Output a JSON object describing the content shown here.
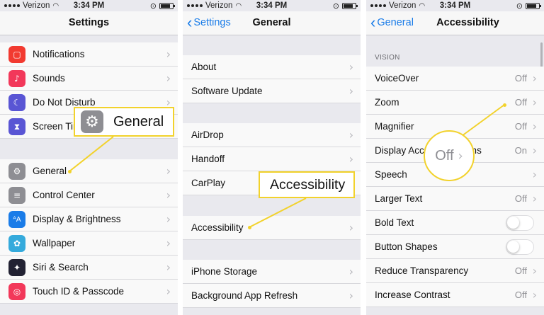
{
  "status_bar": {
    "carrier": "Verizon",
    "time": "3:34 PM"
  },
  "panel_settings": {
    "title": "Settings",
    "items": [
      {
        "label": "Notifications",
        "icon": "notifications-icon",
        "color": "#f23a30"
      },
      {
        "label": "Sounds",
        "icon": "sounds-icon",
        "color": "#f2385a"
      },
      {
        "label": "Do Not Disturb",
        "icon": "moon-icon",
        "color": "#5955d4"
      },
      {
        "label": "Screen Time",
        "icon": "hourglass-icon",
        "color": "#5955d4"
      },
      {
        "label": "General",
        "icon": "gear-icon",
        "color": "#8e8e93"
      },
      {
        "label": "Control Center",
        "icon": "switches-icon",
        "color": "#8e8e93"
      },
      {
        "label": "Display & Brightness",
        "icon": "text-size-icon",
        "color": "#1a7ce8"
      },
      {
        "label": "Wallpaper",
        "icon": "flower-icon",
        "color": "#35aadc"
      },
      {
        "label": "Siri & Search",
        "icon": "siri-icon",
        "color": "#222233"
      },
      {
        "label": "Touch ID & Passcode",
        "icon": "fingerprint-icon",
        "color": "#f2385a"
      }
    ]
  },
  "panel_general": {
    "back": "Settings",
    "title": "General",
    "items": [
      {
        "label": "About"
      },
      {
        "label": "Software Update"
      },
      {
        "label": "AirDrop"
      },
      {
        "label": "Handoff"
      },
      {
        "label": "CarPlay"
      },
      {
        "label": "Accessibility"
      },
      {
        "label": "iPhone Storage"
      },
      {
        "label": "Background App Refresh"
      }
    ]
  },
  "panel_accessibility": {
    "back": "General",
    "title": "Accessibility",
    "section": "VISION",
    "items": [
      {
        "label": "VoiceOver",
        "value": "Off"
      },
      {
        "label": "Zoom",
        "value": "Off"
      },
      {
        "label": "Magnifier",
        "value": "Off"
      },
      {
        "label": "Display Accommodations",
        "value": "On"
      },
      {
        "label": "Speech",
        "value": ""
      },
      {
        "label": "Larger Text",
        "value": "Off"
      },
      {
        "label": "Bold Text",
        "toggle": "off"
      },
      {
        "label": "Button Shapes",
        "toggle": "off"
      },
      {
        "label": "Reduce Transparency",
        "value": "Off"
      },
      {
        "label": "Increase Contrast",
        "value": "Off"
      }
    ]
  },
  "callouts": {
    "general": "General",
    "accessibility": "Accessibility",
    "zoom_value": "Off"
  },
  "colors": {
    "accent": "#1a7ce8",
    "highlight": "#f2d22c"
  }
}
